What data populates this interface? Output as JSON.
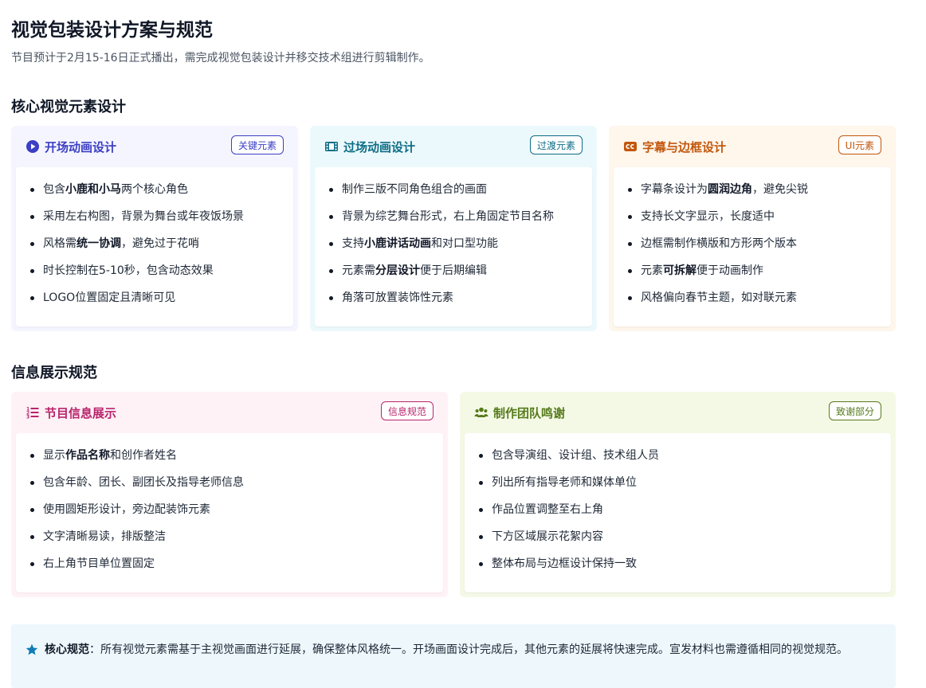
{
  "page": {
    "title": "视觉包装设计方案与规范",
    "subtitle": "节目预计于2月15-16日正式播出，需完成视觉包装设计并移交技术组进行剪辑制作。"
  },
  "sections": [
    {
      "title": "核心视觉元素设计"
    },
    {
      "title": "信息展示规范"
    }
  ],
  "cards": [
    {
      "title": "开场动画设计",
      "badge": "关键元素",
      "icon": "play-circle-icon",
      "accent": "#3b3fc4",
      "bg": "#f5f5ff",
      "items": [
        {
          "pre": "包含",
          "bold": "小鹿和小马",
          "post": "两个核心角色"
        },
        {
          "pre": "采用左右构图，背景为舞台或年夜饭场景",
          "bold": "",
          "post": ""
        },
        {
          "pre": "风格需",
          "bold": "统一协调",
          "post": "，避免过于花哨"
        },
        {
          "pre": "时长控制在5-10秒，包含动态效果",
          "bold": "",
          "post": ""
        },
        {
          "pre": "LOGO位置固定且清晰可见",
          "bold": "",
          "post": ""
        }
      ]
    },
    {
      "title": "过场动画设计",
      "badge": "过渡元素",
      "icon": "film-icon",
      "accent": "#0e6e86",
      "bg": "#ecf9fc",
      "items": [
        {
          "pre": "制作三版不同角色组合的画面",
          "bold": "",
          "post": ""
        },
        {
          "pre": "背景为综艺舞台形式，右上角固定节目名称",
          "bold": "",
          "post": ""
        },
        {
          "pre": "支持",
          "bold": "小鹿讲话动画",
          "post": "和对口型功能"
        },
        {
          "pre": "元素需",
          "bold": "分层设计",
          "post": "便于后期编辑"
        },
        {
          "pre": "角落可放置装饰性元素",
          "bold": "",
          "post": ""
        }
      ]
    },
    {
      "title": "字幕与边框设计",
      "badge": "UI元素",
      "icon": "closed-caption-icon",
      "accent": "#c2570c",
      "bg": "#fff6ec",
      "items": [
        {
          "pre": "字幕条设计为",
          "bold": "圆润边角",
          "post": "，避免尖锐"
        },
        {
          "pre": "支持长文字显示，长度适中",
          "bold": "",
          "post": ""
        },
        {
          "pre": "边框需制作横版和方形两个版本",
          "bold": "",
          "post": ""
        },
        {
          "pre": "元素",
          "bold": "可拆解",
          "post": "便于动画制作"
        },
        {
          "pre": "风格偏向春节主题，如对联元素",
          "bold": "",
          "post": ""
        }
      ]
    },
    {
      "title": "节目信息展示",
      "badge": "信息规范",
      "icon": "list-ordered-icon",
      "accent": "#b8246b",
      "bg": "#fff2f7",
      "items": [
        {
          "pre": "显示",
          "bold": "作品名称",
          "post": "和创作者姓名"
        },
        {
          "pre": "包含年龄、团长、副团长及指导老师信息",
          "bold": "",
          "post": ""
        },
        {
          "pre": "使用圆矩形设计，旁边配装饰元素",
          "bold": "",
          "post": ""
        },
        {
          "pre": "文字清晰易读，排版整洁",
          "bold": "",
          "post": ""
        },
        {
          "pre": "右上角节目单位置固定",
          "bold": "",
          "post": ""
        }
      ]
    },
    {
      "title": "制作团队鸣谢",
      "badge": "致谢部分",
      "icon": "users-icon",
      "accent": "#557a1a",
      "bg": "#f4f9e6",
      "items": [
        {
          "pre": "包含导演组、设计组、技术组人员",
          "bold": "",
          "post": ""
        },
        {
          "pre": "列出所有指导老师和媒体单位",
          "bold": "",
          "post": ""
        },
        {
          "pre": "作品位置调整至右上角",
          "bold": "",
          "post": ""
        },
        {
          "pre": "下方区域展示花絮内容",
          "bold": "",
          "post": ""
        },
        {
          "pre": "整体布局与边框设计保持一致",
          "bold": "",
          "post": ""
        }
      ]
    }
  ],
  "note": {
    "icon": "star-icon",
    "label": "核心规范",
    "text": "：所有视觉元素需基于主视觉画面进行延展，确保整体风格统一。开场画面设计完成后，其他元素的延展将快速完成。宣发材料也需遵循相同的视觉规范。",
    "accent": "#0f7cb5"
  }
}
